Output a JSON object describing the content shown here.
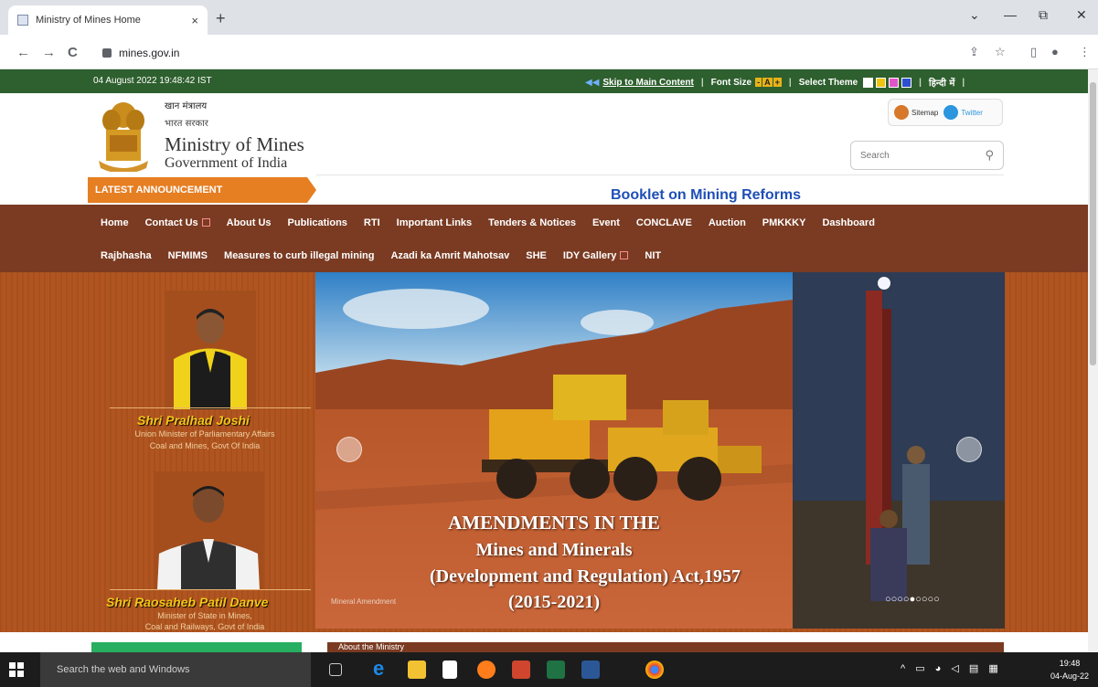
{
  "browser": {
    "tab_title": "Ministry of Mines Home",
    "tab_close": "×",
    "new_tab": "+",
    "url": "mines.gov.in",
    "back": "←",
    "forward": "→",
    "reload": "C",
    "win_min": "—",
    "win_max": "⧉",
    "win_close": "✕",
    "win_dropdown": "⌄"
  },
  "topbar": {
    "datetime": "04 August 2022 19:48:42 IST",
    "skip_link": "Skip to Main Content",
    "font_size_label": "Font Size",
    "font_minus": "-",
    "font_normal": "A",
    "font_plus": "+",
    "theme_label": "Select Theme",
    "language": "हिन्दी में",
    "theme_colors": [
      "#ffffff",
      "#f1c40f",
      "#e056c8",
      "#2e4fcf"
    ]
  },
  "header": {
    "hindi_ministry": "खान मंत्रालय",
    "hindi_govt": "भारत सरकार",
    "ministry": "Ministry of Mines",
    "govt": "Government of India",
    "sitemap": "Sitemap",
    "twitter": "Twitter",
    "search_placeholder": "Search",
    "latest": "LATEST ANNOUNCEMENT",
    "booklet": "Booklet on Mining Reforms"
  },
  "nav": {
    "row1": [
      "Home",
      "Contact Us",
      "About Us",
      "Publications",
      "RTI",
      "Important Links",
      "Tenders & Notices",
      "Event",
      "CONCLAVE",
      "Auction",
      "PMKKKY",
      "Dashboard"
    ],
    "row2": [
      "Rajbhasha",
      "NFMIMS",
      "Measures to curb illegal mining",
      "Azadi ka Amrit Mahotsav",
      "SHE",
      "IDY Gallery",
      "NIT"
    ]
  },
  "ministers": [
    {
      "name": "Shri Pralhad Joshi",
      "role1": "Union Minister of Parliamentary Affairs",
      "role2": "Coal and Mines, Govt Of India"
    },
    {
      "name": "Shri Raosaheb Patil Danve",
      "role1": "Minister of State in Mines,",
      "role2": "Coal and Railways, Govt of India"
    }
  ],
  "slide": {
    "line1": "AMENDMENTS IN THE",
    "line2": "Mines and Minerals",
    "line3": "(Development and Regulation) Act,1957",
    "line4": "(2015-2021)",
    "caption": "Mineral Amendment",
    "dots": "○○○○●○○○○"
  },
  "below": {
    "brown_label": "About the Ministry"
  },
  "taskbar": {
    "search": "Search the web and Windows",
    "time": "19:48",
    "date": "04-Aug-22"
  }
}
